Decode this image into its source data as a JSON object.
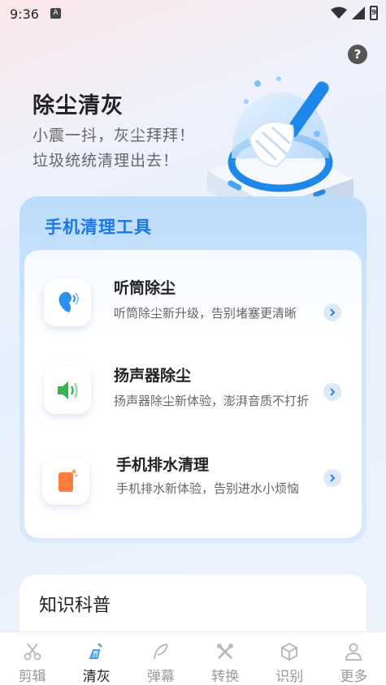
{
  "status_bar": {
    "time": "9:36",
    "notif_letter": "A",
    "battery_digit": "9"
  },
  "header": {
    "help_label": "?"
  },
  "hero": {
    "title": "除尘清灰",
    "subtitle_line1": "小震一抖，灰尘拜拜！",
    "subtitle_line2": "垃圾统统清理出去！"
  },
  "tools": {
    "title": "手机清理工具",
    "items": [
      {
        "name": "听筒除尘",
        "desc": "听筒除尘新升级，告别堵塞更清晰",
        "icon": "earpiece-icon"
      },
      {
        "name": "扬声器除尘",
        "desc": "扬声器除尘新体验，澎湃音质不打折",
        "icon": "speaker-icon"
      },
      {
        "name": "手机排水清理",
        "desc": "手机排水新体验，告别进水小烦恼",
        "icon": "water-drain-icon"
      }
    ]
  },
  "knowledge": {
    "title": "知识科普"
  },
  "nav": {
    "items": [
      {
        "label": "剪辑",
        "icon": "scissors-icon",
        "active": false
      },
      {
        "label": "清灰",
        "icon": "broom-icon",
        "active": true
      },
      {
        "label": "弹幕",
        "icon": "feather-icon",
        "active": false
      },
      {
        "label": "转换",
        "icon": "tools-icon",
        "active": false
      },
      {
        "label": "识别",
        "icon": "cube-icon",
        "active": false
      },
      {
        "label": "更多",
        "icon": "person-icon",
        "active": false
      }
    ]
  },
  "colors": {
    "accent": "#1c77e6",
    "nav_active": "#4a9cf0"
  }
}
